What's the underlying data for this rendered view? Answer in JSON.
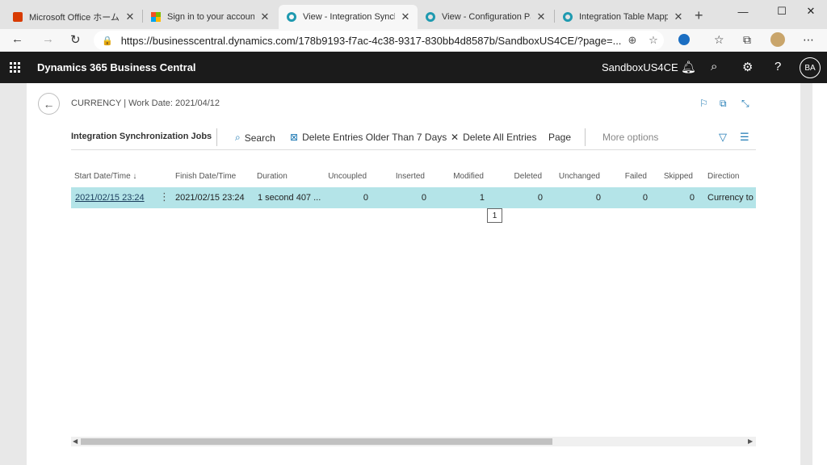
{
  "browser": {
    "tabs": [
      {
        "title": "Microsoft Office ホーム",
        "favicon": "office-icon"
      },
      {
        "title": "Sign in to your account",
        "favicon": "microsoft-icon"
      },
      {
        "title": "View - Integration Synchro",
        "favicon": "d365-icon"
      },
      {
        "title": "View - Configuration Packa",
        "favicon": "d365-icon"
      },
      {
        "title": "Integration Table Mapping",
        "favicon": "d365-icon"
      }
    ],
    "url": "https://businesscentral.dynamics.com/178b9193-f7ac-4c38-9317-830bb4d8587b/SandboxUS4CE/?page=..."
  },
  "app": {
    "name": "Dynamics 365 Business Central",
    "environment": "SandboxUS4CE",
    "user_initials": "BA"
  },
  "page": {
    "caption": "CURRENCY | Work Date: 2021/04/12",
    "actions": {
      "title": "Integration Synchronization Jobs",
      "search": "Search",
      "delete_older": "Delete Entries Older Than 7 Days",
      "delete_all": "Delete All Entries",
      "page": "Page",
      "more": "More options"
    }
  },
  "grid": {
    "columns": {
      "start": "Start Date/Time ↓",
      "finish": "Finish Date/Time",
      "duration": "Duration",
      "uncoupled": "Uncoupled",
      "inserted": "Inserted",
      "modified": "Modified",
      "deleted": "Deleted",
      "unchanged": "Unchanged",
      "failed": "Failed",
      "skipped": "Skipped",
      "direction": "Direction"
    },
    "rows": [
      {
        "start": "2021/02/15 23:24",
        "finish": "2021/02/15 23:24",
        "duration": "1 second 407 ...",
        "uncoupled": "0",
        "inserted": "0",
        "modified": "1",
        "deleted": "0",
        "unchanged": "0",
        "failed": "0",
        "skipped": "0",
        "direction": "Currency to"
      }
    ],
    "selected_count": "1"
  },
  "colors": {
    "selected_row": "#b4e4e8",
    "app_bar": "#1b1b1b",
    "accent": "#1f7ab4"
  }
}
